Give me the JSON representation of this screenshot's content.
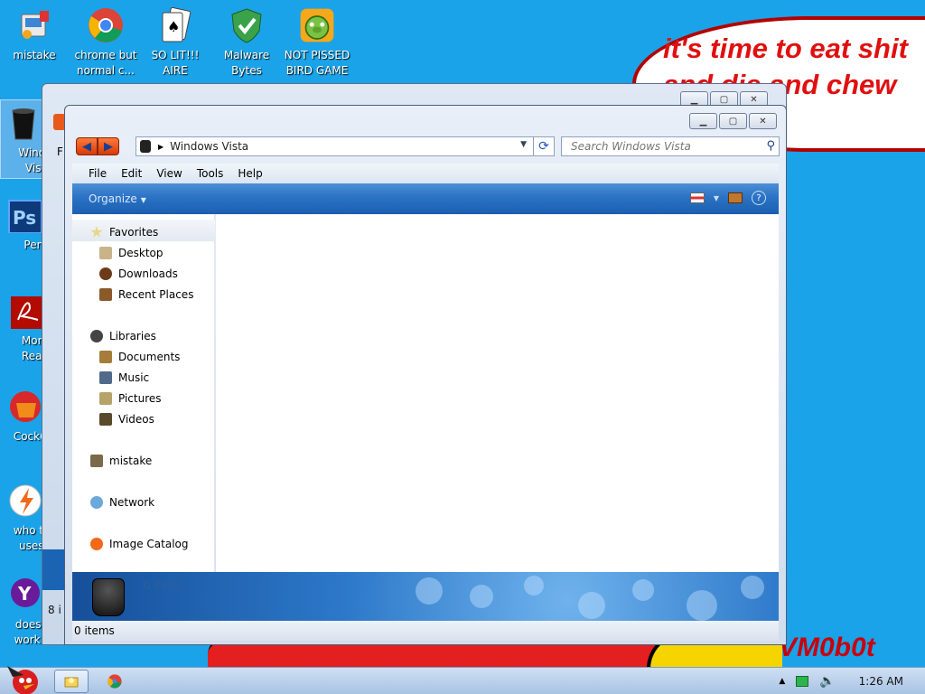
{
  "wallpaper": {
    "bubble_text": "it's time to eat shit\nand die and chew\ngum",
    "watermark": "VM0b0t"
  },
  "desktop_icons": [
    {
      "label": "mistake",
      "icon": "control-panel-icon"
    },
    {
      "label": "chrome but normal c...",
      "icon": "chrome-icon"
    },
    {
      "label": "SO LIT!!! AIRE",
      "icon": "solitaire-icon"
    },
    {
      "label": "Malware Bytes",
      "icon": "malwarebytes-shield-icon"
    },
    {
      "label": "NOT PISSED BIRD GAME",
      "icon": "angry-birds-pig-icon"
    }
  ],
  "left_icons": [
    {
      "label": "Windo Vist",
      "icon": "recycle-bin-icon"
    },
    {
      "label": "Peni",
      "icon": "photoshop-icon"
    },
    {
      "label": "Morb Read",
      "icon": "acrobat-reader-icon"
    },
    {
      "label": "CockCle",
      "icon": "ccleaner-icon"
    },
    {
      "label": "who the uses t",
      "icon": "lightning-icon"
    },
    {
      "label": "doesn't work lol",
      "icon": "yahoo-icon"
    }
  ],
  "back_window": {
    "menu_partial": "F",
    "status_partial": "8 i"
  },
  "window": {
    "address": "Windows Vista",
    "search_placeholder": "Search Windows Vista",
    "menu": [
      "File",
      "Edit",
      "View",
      "Tools",
      "Help"
    ],
    "organize_label": "Organize",
    "nav": {
      "favorites": "Favorites",
      "favorite_items": [
        "Desktop",
        "Downloads",
        "Recent Places"
      ],
      "libraries": "Libraries",
      "library_items": [
        "Documents",
        "Music",
        "Pictures",
        "Videos"
      ],
      "mistake": "mistake",
      "network": "Network",
      "image_catalog": "Image Catalog"
    },
    "details_count": "0 items",
    "status_count": "0 items"
  },
  "taskbar": {
    "clock": "1:26 AM"
  }
}
